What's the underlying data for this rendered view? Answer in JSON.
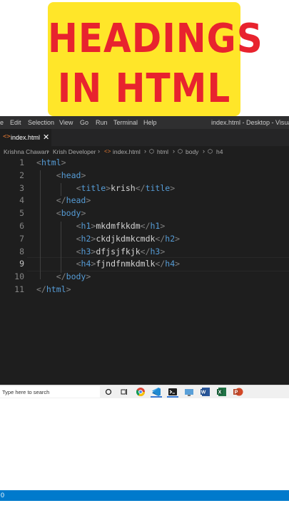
{
  "banner": {
    "line1": "HEADINGS",
    "line2": "IN HTML"
  },
  "menubar": {
    "items": [
      "e",
      "Edit",
      "Selection",
      "View",
      "Go",
      "Run",
      "Terminal",
      "Help"
    ],
    "window_title": "index.html - Desktop - Visual St"
  },
  "tab": {
    "icon": "html-file-icon",
    "label": "index.html",
    "close": "✕"
  },
  "breadcrumbs": [
    "Krishna Chawan",
    "Krish Developer",
    "index.html",
    "html",
    "body",
    "h4"
  ],
  "editor": {
    "line_numbers": [
      "1",
      "2",
      "3",
      "4",
      "5",
      "6",
      "7",
      "8",
      "9",
      "10",
      "11"
    ],
    "active_line": "9",
    "lines": [
      {
        "open": "html",
        "text": "",
        "close": ""
      },
      {
        "open": "head",
        "text": "",
        "close": ""
      },
      {
        "open": "title",
        "text": "krish",
        "close": "title"
      },
      {
        "open": "",
        "text": "",
        "close": "head"
      },
      {
        "open": "body",
        "text": "",
        "close": ""
      },
      {
        "open": "h1",
        "text": "mkdmfkkdm",
        "close": "h1"
      },
      {
        "open": "h2",
        "text": "ckdjkdmkcmdk",
        "close": "h2"
      },
      {
        "open": "h3",
        "text": "dfjsjfkjk",
        "close": "h3"
      },
      {
        "open": "h4",
        "text": "fjndfnmkdmlk",
        "close": "h4"
      },
      {
        "open": "",
        "text": "",
        "close": "body"
      },
      {
        "open": "",
        "text": "",
        "close": "html"
      }
    ]
  },
  "statusbar": {
    "left": "0"
  },
  "taskbar": {
    "search_placeholder": "Type here to search",
    "icons": [
      "cortana-icon",
      "task-view-icon",
      "chrome-icon",
      "vscode-icon",
      "terminal-icon",
      "screen-icon",
      "word-icon",
      "excel-icon",
      "powerpoint-icon"
    ]
  },
  "colors": {
    "banner_bg": "#ffe629",
    "banner_text": "#e8232e",
    "editor_bg": "#1e1e1e",
    "tag": "#569cd6",
    "punct": "#808080",
    "statusbar": "#007acc"
  }
}
